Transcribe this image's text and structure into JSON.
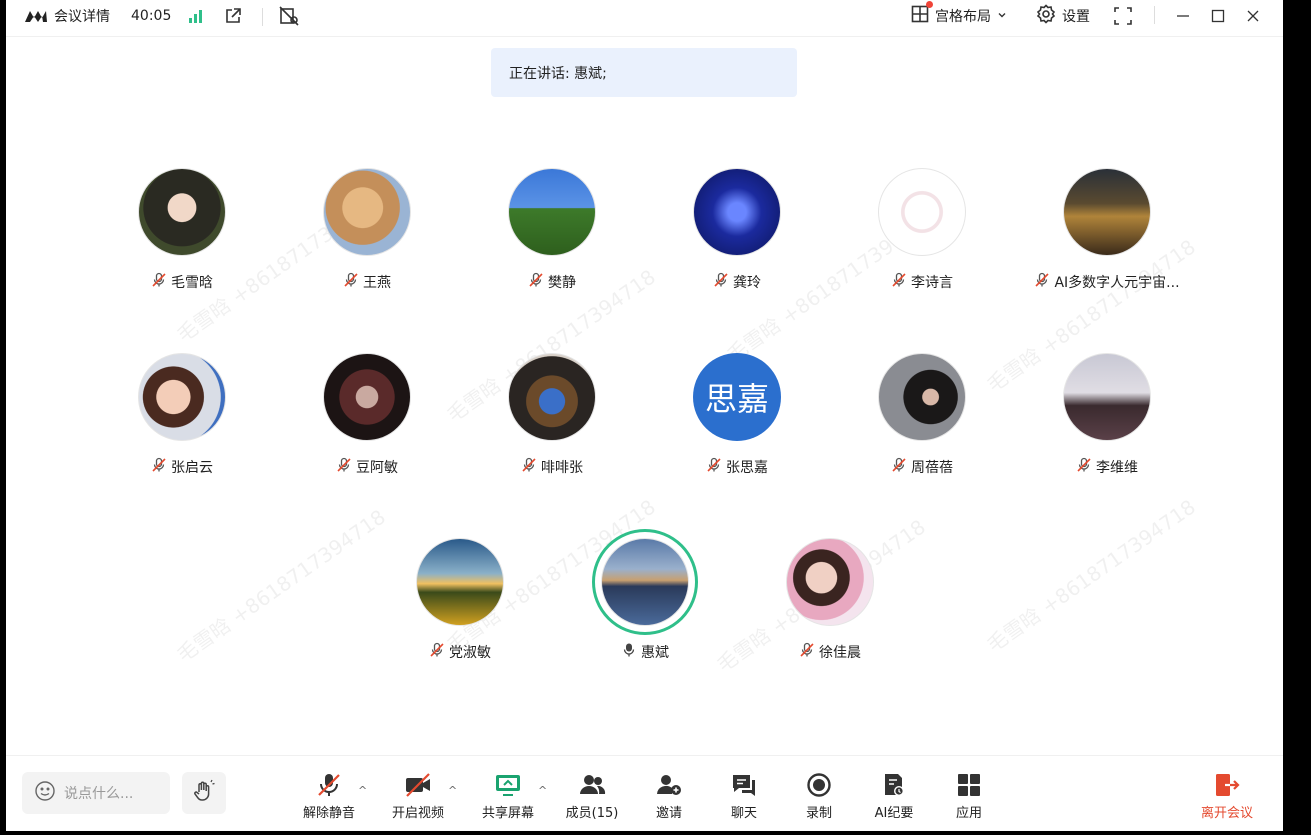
{
  "header": {
    "meeting_title": "会议详情",
    "timer": "40:05",
    "layout_label": "宫格布局",
    "settings_label": "设置"
  },
  "speaking": {
    "text": "正在讲话: 惠斌;"
  },
  "watermark": {
    "text": "毛雪晗 +8618717394718"
  },
  "participants": [
    {
      "name": "毛雪晗",
      "muted": true,
      "avatar": "anime-girl"
    },
    {
      "name": "王燕",
      "muted": true,
      "avatar": "dogs"
    },
    {
      "name": "樊静",
      "muted": true,
      "avatar": "tree-sky"
    },
    {
      "name": "龚玲",
      "muted": true,
      "avatar": "zodiac-blue"
    },
    {
      "name": "李诗言",
      "muted": true,
      "avatar": "sketch-girl"
    },
    {
      "name": "AI多数字人元宇宙...",
      "muted": true,
      "avatar": "palace"
    },
    {
      "name": "张启云",
      "muted": true,
      "avatar": "woman-portrait"
    },
    {
      "name": "豆阿敏",
      "muted": true,
      "avatar": "dark-art"
    },
    {
      "name": "啡啡张",
      "muted": true,
      "avatar": "anime-blue"
    },
    {
      "name": "张思嘉",
      "muted": true,
      "avatar_text": "思嘉",
      "avatar_color": "#2b6fce"
    },
    {
      "name": "周蓓蓓",
      "muted": true,
      "avatar": "woman-gray"
    },
    {
      "name": "李维维",
      "muted": true,
      "avatar": "woman-dusk"
    },
    {
      "name": "党淑敏",
      "muted": true,
      "avatar": "sunflowers"
    },
    {
      "name": "惠斌",
      "muted": false,
      "speaking": true,
      "avatar": "city-night"
    },
    {
      "name": "徐佳晨",
      "muted": true,
      "avatar": "girl-flowers"
    }
  ],
  "chat": {
    "placeholder": "说点什么..."
  },
  "controls": {
    "unmute": "解除静音",
    "start_video": "开启视频",
    "share_screen": "共享屏幕",
    "members": "成员(15)",
    "invite": "邀请",
    "chat": "聊天",
    "record": "录制",
    "ai_summary": "AI纪要",
    "apps": "应用",
    "leave": "离开会议"
  },
  "colors": {
    "accent_green": "#2fbf8a",
    "leave_red": "#e44a2f",
    "banner_bg": "#eaf1fd"
  }
}
